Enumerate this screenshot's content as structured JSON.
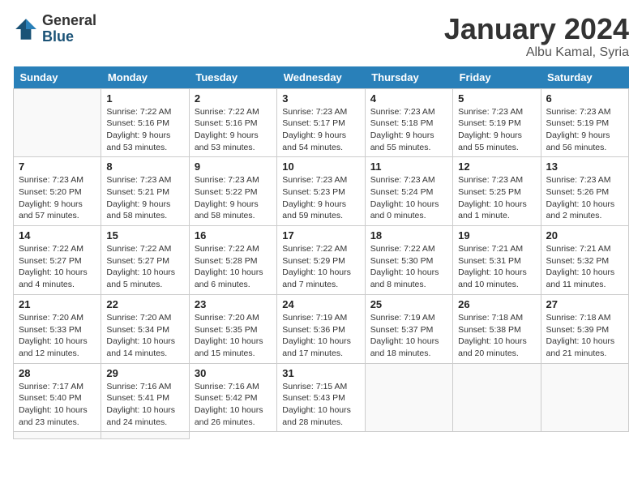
{
  "logo": {
    "general": "General",
    "blue": "Blue"
  },
  "title": "January 2024",
  "subtitle": "Albu Kamal, Syria",
  "weekdays": [
    "Sunday",
    "Monday",
    "Tuesday",
    "Wednesday",
    "Thursday",
    "Friday",
    "Saturday"
  ],
  "days": [
    {
      "day": null
    },
    {
      "day": 1,
      "sunrise": "7:22 AM",
      "sunset": "5:16 PM",
      "daylight": "9 hours and 53 minutes."
    },
    {
      "day": 2,
      "sunrise": "7:22 AM",
      "sunset": "5:16 PM",
      "daylight": "9 hours and 53 minutes."
    },
    {
      "day": 3,
      "sunrise": "7:23 AM",
      "sunset": "5:17 PM",
      "daylight": "9 hours and 54 minutes."
    },
    {
      "day": 4,
      "sunrise": "7:23 AM",
      "sunset": "5:18 PM",
      "daylight": "9 hours and 55 minutes."
    },
    {
      "day": 5,
      "sunrise": "7:23 AM",
      "sunset": "5:19 PM",
      "daylight": "9 hours and 55 minutes."
    },
    {
      "day": 6,
      "sunrise": "7:23 AM",
      "sunset": "5:19 PM",
      "daylight": "9 hours and 56 minutes."
    },
    {
      "day": 7,
      "sunrise": "7:23 AM",
      "sunset": "5:20 PM",
      "daylight": "9 hours and 57 minutes."
    },
    {
      "day": 8,
      "sunrise": "7:23 AM",
      "sunset": "5:21 PM",
      "daylight": "9 hours and 58 minutes."
    },
    {
      "day": 9,
      "sunrise": "7:23 AM",
      "sunset": "5:22 PM",
      "daylight": "9 hours and 58 minutes."
    },
    {
      "day": 10,
      "sunrise": "7:23 AM",
      "sunset": "5:23 PM",
      "daylight": "9 hours and 59 minutes."
    },
    {
      "day": 11,
      "sunrise": "7:23 AM",
      "sunset": "5:24 PM",
      "daylight": "10 hours and 0 minutes."
    },
    {
      "day": 12,
      "sunrise": "7:23 AM",
      "sunset": "5:25 PM",
      "daylight": "10 hours and 1 minute."
    },
    {
      "day": 13,
      "sunrise": "7:23 AM",
      "sunset": "5:26 PM",
      "daylight": "10 hours and 2 minutes."
    },
    {
      "day": 14,
      "sunrise": "7:22 AM",
      "sunset": "5:27 PM",
      "daylight": "10 hours and 4 minutes."
    },
    {
      "day": 15,
      "sunrise": "7:22 AM",
      "sunset": "5:27 PM",
      "daylight": "10 hours and 5 minutes."
    },
    {
      "day": 16,
      "sunrise": "7:22 AM",
      "sunset": "5:28 PM",
      "daylight": "10 hours and 6 minutes."
    },
    {
      "day": 17,
      "sunrise": "7:22 AM",
      "sunset": "5:29 PM",
      "daylight": "10 hours and 7 minutes."
    },
    {
      "day": 18,
      "sunrise": "7:22 AM",
      "sunset": "5:30 PM",
      "daylight": "10 hours and 8 minutes."
    },
    {
      "day": 19,
      "sunrise": "7:21 AM",
      "sunset": "5:31 PM",
      "daylight": "10 hours and 10 minutes."
    },
    {
      "day": 20,
      "sunrise": "7:21 AM",
      "sunset": "5:32 PM",
      "daylight": "10 hours and 11 minutes."
    },
    {
      "day": 21,
      "sunrise": "7:20 AM",
      "sunset": "5:33 PM",
      "daylight": "10 hours and 12 minutes."
    },
    {
      "day": 22,
      "sunrise": "7:20 AM",
      "sunset": "5:34 PM",
      "daylight": "10 hours and 14 minutes."
    },
    {
      "day": 23,
      "sunrise": "7:20 AM",
      "sunset": "5:35 PM",
      "daylight": "10 hours and 15 minutes."
    },
    {
      "day": 24,
      "sunrise": "7:19 AM",
      "sunset": "5:36 PM",
      "daylight": "10 hours and 17 minutes."
    },
    {
      "day": 25,
      "sunrise": "7:19 AM",
      "sunset": "5:37 PM",
      "daylight": "10 hours and 18 minutes."
    },
    {
      "day": 26,
      "sunrise": "7:18 AM",
      "sunset": "5:38 PM",
      "daylight": "10 hours and 20 minutes."
    },
    {
      "day": 27,
      "sunrise": "7:18 AM",
      "sunset": "5:39 PM",
      "daylight": "10 hours and 21 minutes."
    },
    {
      "day": 28,
      "sunrise": "7:17 AM",
      "sunset": "5:40 PM",
      "daylight": "10 hours and 23 minutes."
    },
    {
      "day": 29,
      "sunrise": "7:16 AM",
      "sunset": "5:41 PM",
      "daylight": "10 hours and 24 minutes."
    },
    {
      "day": 30,
      "sunrise": "7:16 AM",
      "sunset": "5:42 PM",
      "daylight": "10 hours and 26 minutes."
    },
    {
      "day": 31,
      "sunrise": "7:15 AM",
      "sunset": "5:43 PM",
      "daylight": "10 hours and 28 minutes."
    },
    {
      "day": null
    },
    {
      "day": null
    },
    {
      "day": null
    },
    {
      "day": null
    },
    {
      "day": null
    }
  ],
  "labels": {
    "sunrise": "Sunrise:",
    "sunset": "Sunset:",
    "daylight": "Daylight:"
  }
}
